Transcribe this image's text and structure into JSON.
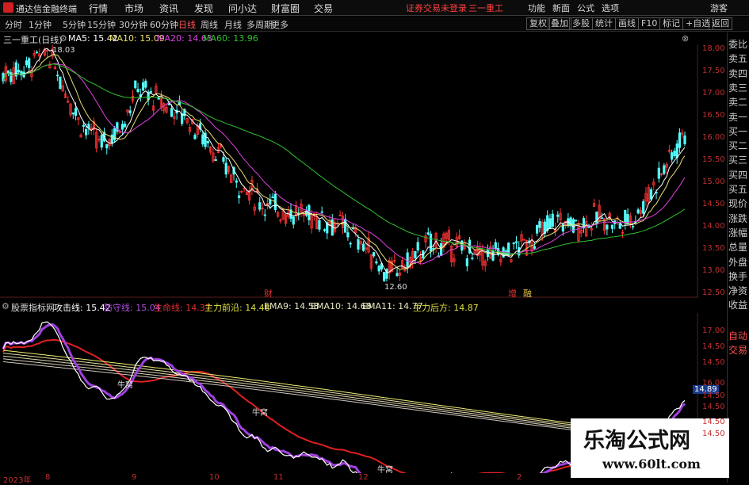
{
  "menubar": {
    "app_title": "通达信金融终端",
    "items": [
      "行情",
      "市场",
      "资讯",
      "发现",
      "问小达",
      "财富圈",
      "交易"
    ],
    "status": "证券交易未登录",
    "stock": "三一重工",
    "right_items": [
      "功能",
      "新面",
      "公式",
      "选项"
    ],
    "user": "游客"
  },
  "toolbar": {
    "periods": [
      "分时",
      "1分钟",
      "5分钟",
      "15分钟",
      "30分钟",
      "60分钟",
      "日线",
      "周线",
      "月线",
      "多周期",
      "更多"
    ],
    "active_period": "日线",
    "right_tools": [
      "复权",
      "叠加",
      "多股",
      "统计",
      "画线",
      "F10",
      "标记",
      "+自选",
      "返回"
    ]
  },
  "chart_info": {
    "name": "三一重工(日线)",
    "ma5": "MA5: 15.42",
    "ma10": "MA10: 15.09",
    "ma20": "MA20: 14.63",
    "ma60": "MA60: 13.96",
    "high_label": "18.03",
    "low_label": "12.60",
    "marks": [
      "财",
      "增",
      "融"
    ]
  },
  "price_axis": [
    "18.00",
    "17.50",
    "17.00",
    "16.50",
    "16.00",
    "15.50",
    "15.00",
    "14.50",
    "14.00",
    "13.50",
    "13.00",
    "12.50"
  ],
  "indicator_info": {
    "name": "股票指标网",
    "attack": "攻击线: 15.42",
    "defend": "防守线: 15.04",
    "lifeline": "生命线: 14.37",
    "main_front": "主力前沿: 14.48",
    "ema9": "EMA9: 14.58",
    "ema10": "EMA10: 14.68",
    "ema11": "EMA11: 14.77",
    "main_back": "主力后方: 14.87",
    "labels": [
      "牛窝",
      "牛窝",
      "牛窝"
    ]
  },
  "indicator_axis": [
    "17.00",
    "14.50",
    "14.50",
    "16.00",
    "14.50",
    "14.50",
    "14.50",
    "14.50"
  ],
  "current_value": "14.89",
  "xaxis": [
    "2023年",
    "8",
    "9",
    "10",
    "11",
    "12",
    "2"
  ],
  "sidepanel": [
    "委比",
    "卖五",
    "卖四",
    "卖三",
    "卖二",
    "卖一",
    "买一",
    "买二",
    "买三",
    "买四",
    "买五",
    "现价",
    "涨跌",
    "涨幅",
    "总量",
    "外盘",
    "换手",
    "净资",
    "收益",
    "自动",
    "交易"
  ],
  "watermark": {
    "title": "乐淘公式网",
    "url": "www.60lt.com"
  },
  "colors": {
    "up": "#ff3333",
    "down": "#54ffff",
    "ma5": "#ffffff",
    "ma10": "#e8e070",
    "ma20": "#e040e0",
    "ma60": "#30c030",
    "axis": "#c03030"
  }
}
